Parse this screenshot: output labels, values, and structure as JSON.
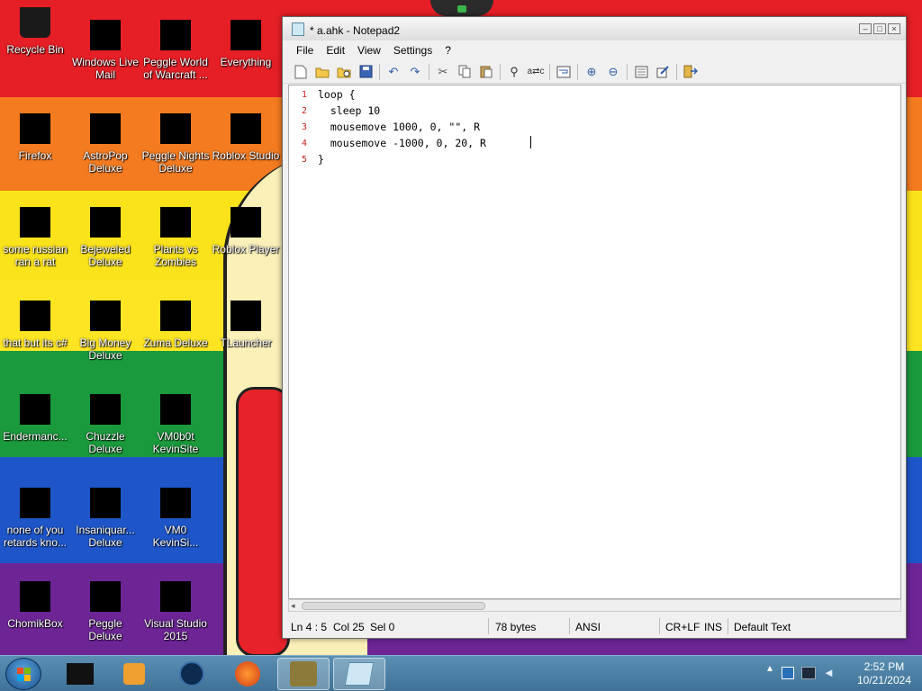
{
  "desktop": {
    "icons": [
      {
        "label": "Recycle Bin"
      },
      {
        "label": "Windows Live Mail"
      },
      {
        "label": "Peggle World of Warcraft ..."
      },
      {
        "label": "Everything"
      },
      {
        "label": "Firefox"
      },
      {
        "label": "AstroPop Deluxe"
      },
      {
        "label": "Peggle Nights Deluxe"
      },
      {
        "label": "Roblox Studio"
      },
      {
        "label": "some russian ran a rat"
      },
      {
        "label": "Bejeweled Deluxe"
      },
      {
        "label": "Plants vs Zombies"
      },
      {
        "label": "Roblox Player"
      },
      {
        "label": "that but its c#"
      },
      {
        "label": "Big Money Deluxe"
      },
      {
        "label": "Zuma Deluxe"
      },
      {
        "label": "TLauncher"
      },
      {
        "label": "Endermanc..."
      },
      {
        "label": "Chuzzle Deluxe"
      },
      {
        "label": "VM0b0t KevinSite"
      },
      {
        "label": "none of you retards kno..."
      },
      {
        "label": "Insaniquar... Deluxe"
      },
      {
        "label": "VM0 KevinSi..."
      },
      {
        "label": "ChomikBox"
      },
      {
        "label": "Peggle Deluxe"
      },
      {
        "label": "Visual Studio 2015"
      }
    ]
  },
  "window": {
    "title": "* a.ahk - Notepad2",
    "controls": {
      "minimize": "–",
      "maximize": "□",
      "close": "×"
    },
    "menu": [
      "File",
      "Edit",
      "View",
      "Settings",
      "?"
    ],
    "toolbar_icons": [
      "new-icon",
      "open-icon",
      "browse-icon",
      "save-icon",
      "undo-icon",
      "redo-icon",
      "cut-icon",
      "copy-icon",
      "paste-icon",
      "find-icon",
      "replace-icon",
      "wordwrap-icon",
      "zoom-in-icon",
      "zoom-out-icon",
      "scheme-icon",
      "customize-icon",
      "exit-icon"
    ],
    "editor": {
      "line_numbers": [
        "1",
        "2",
        "3",
        "4",
        "5"
      ],
      "lines": [
        "loop {",
        "  sleep 10",
        "  mousemove 1000, 0, \"\", R",
        "  mousemove -1000, 0, 20, R",
        "}"
      ]
    },
    "status": {
      "position": "Ln 4 : 5",
      "column": "Col 25",
      "selection": "Sel 0",
      "size": "78 bytes",
      "encoding": "ANSI",
      "line_ending": "CR+LF",
      "mode": "INS",
      "scheme": "Default Text"
    }
  },
  "taskbar": {
    "clock_time": "2:52 PM",
    "clock_date": "10/21/2024"
  },
  "colors": {
    "line_number": "#cc2222",
    "accent_blue": "#2d5ea8",
    "taskbar": "#4a80a5"
  }
}
